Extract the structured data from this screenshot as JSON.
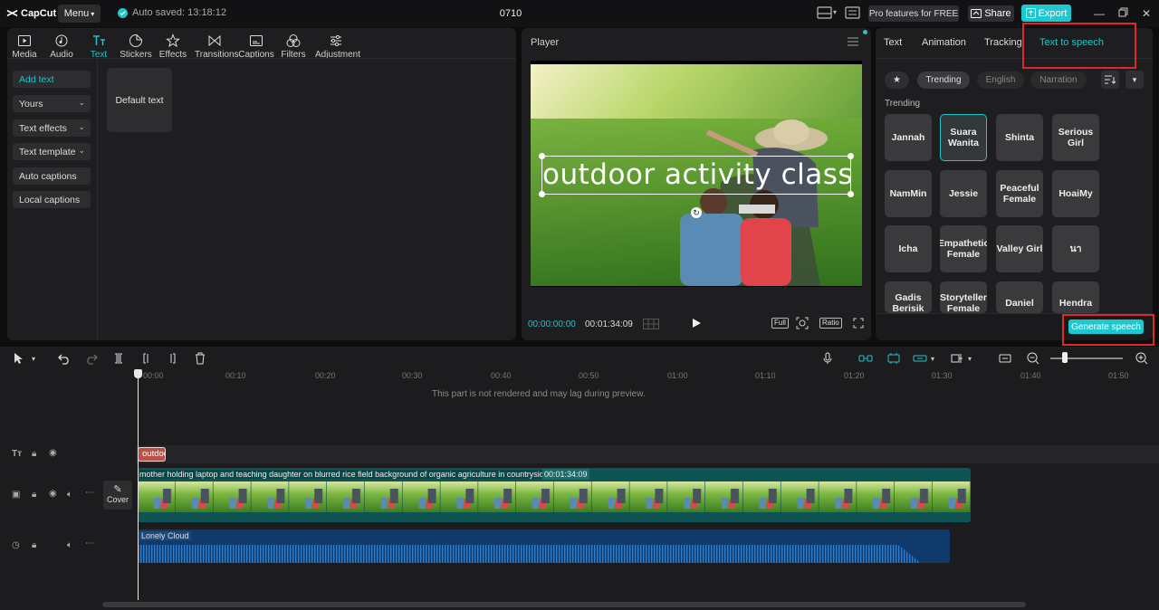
{
  "app": {
    "brand": "CapCut",
    "menu_label": "Menu",
    "autosave": "Auto saved: 13:18:12",
    "project_name": "0710",
    "pro_features": "Pro features for FREE",
    "share": "Share",
    "export": "Export"
  },
  "toolbar": [
    {
      "label": "Media",
      "icon": "media-icon"
    },
    {
      "label": "Audio",
      "icon": "audio-icon"
    },
    {
      "label": "Text",
      "icon": "text-icon",
      "active": true
    },
    {
      "label": "Stickers",
      "icon": "stickers-icon"
    },
    {
      "label": "Effects",
      "icon": "effects-icon"
    },
    {
      "label": "Transitions",
      "icon": "transitions-icon"
    },
    {
      "label": "Captions",
      "icon": "captions-icon"
    },
    {
      "label": "Filters",
      "icon": "filters-icon"
    },
    {
      "label": "Adjustment",
      "icon": "adjustment-icon"
    }
  ],
  "sidebar": [
    {
      "label": "Add text",
      "active": true
    },
    {
      "label": "Yours",
      "dropdown": true
    },
    {
      "label": "Text effects",
      "dropdown": true
    },
    {
      "label": "Text template",
      "dropdown": true
    },
    {
      "label": "Auto captions"
    },
    {
      "label": "Local captions"
    }
  ],
  "default_text_card": "Default text",
  "player": {
    "title": "Player",
    "caption": "outdoor activity class",
    "current_time": "00:00:00:00",
    "total_time": "00:01:34:09",
    "full_label": "Full",
    "ratio_label": "Ratio"
  },
  "right_panel": {
    "tabs": [
      "Text",
      "Animation",
      "Tracking",
      "Text to speech"
    ],
    "active_tab": "Text to speech",
    "filters": [
      "Trending",
      "English",
      "Narration"
    ],
    "section_label": "Trending",
    "voices": [
      [
        "Jannah",
        "Suara Wanita",
        "Shinta",
        "Serious Girl"
      ],
      [
        "NamMin",
        "Jessie",
        "Peaceful Female",
        "HoaiMy"
      ],
      [
        "Icha",
        "Empathetic Female",
        "Valley Girl",
        "นา"
      ],
      [
        "Gadis Berisik",
        "Storyteller Female",
        "Daniel",
        "Hendra"
      ]
    ],
    "selected_voice": "Suara Wanita",
    "generate_label": "Generate speech"
  },
  "timeline": {
    "ruler": [
      "00:00",
      "00:10",
      "00:20",
      "00:30",
      "00:40",
      "00:50",
      "01:00",
      "01:10",
      "01:20",
      "01:30",
      "01:40",
      "01:50"
    ],
    "lag_notice": "This part is not rendered and may lag during preview.",
    "text_clip": "outdoor activity class",
    "video_clip_title": "mother holding laptop and teaching daughter on blurred rice field background of organic agriculture in countryside",
    "video_clip_duration": "00:01:34:09",
    "cover_label": "Cover",
    "audio_clip_title": "Lonely Cloud"
  },
  "colors": {
    "accent": "#20c4cb",
    "highlight_box": "#e0272b",
    "text_clip": "#b85148",
    "video_clip": "#0f5454",
    "audio_clip": "#0f3a6b"
  }
}
